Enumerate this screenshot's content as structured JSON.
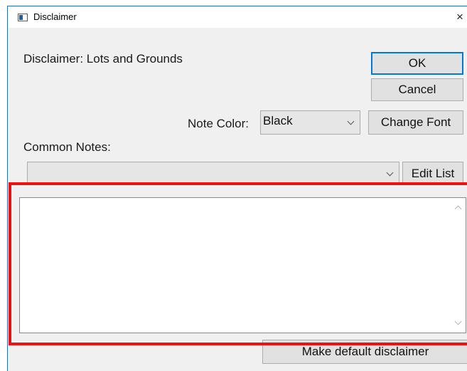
{
  "window": {
    "title": "Disclaimer",
    "close_symbol": "×",
    "icon": "window-app-icon"
  },
  "dialog": {
    "heading": "Disclaimer: Lots and Grounds",
    "ok_label": "OK",
    "cancel_label": "Cancel",
    "note_color_label": "Note Color:",
    "note_color_value": "Black",
    "change_font_label": "Change Font",
    "common_notes_label": "Common Notes:",
    "common_notes_value": "",
    "edit_list_label": "Edit List",
    "notes_text": "",
    "make_default_label": "Make default disclaimer"
  },
  "colors": {
    "highlight": "#ee1111",
    "default_button_border": "#0078d7",
    "window_border": "#1c6fb8"
  }
}
